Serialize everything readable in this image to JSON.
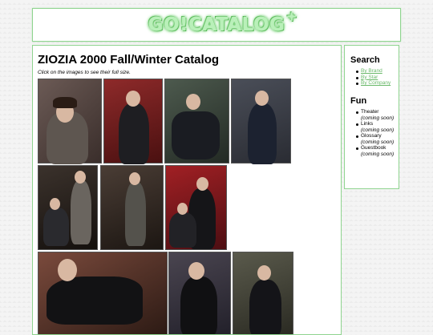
{
  "logo": {
    "text": "GO!CATALOG",
    "plus": "+"
  },
  "main": {
    "title": "ZIOZIA 2000 Fall/Winter Catalog",
    "hint": "Click on the images to see their full size."
  },
  "photos": [
    {
      "label": "photo-1",
      "bg": "#5a4a45"
    },
    {
      "label": "photo-2",
      "bg": "#7a2020"
    },
    {
      "label": "photo-3",
      "bg": "#3d4a3e"
    },
    {
      "label": "photo-4",
      "bg": "#3c3f46"
    },
    {
      "label": "photo-5",
      "bg": "#2b241f"
    },
    {
      "label": "photo-6",
      "bg": "#3a2f29"
    },
    {
      "label": "photo-7",
      "bg": "#8a1e22"
    },
    {
      "label": "photo-8",
      "bg": "#6a3a30"
    },
    {
      "label": "photo-9",
      "bg": "#3d3a40"
    },
    {
      "label": "photo-10",
      "bg": "#4a4a40"
    }
  ],
  "sidebar": {
    "search_heading": "Search",
    "search_links": [
      "By Brand",
      "By Star",
      "By Company"
    ],
    "fun_heading": "Fun",
    "fun_items": [
      {
        "label": "Theater",
        "note": "(coming soon)"
      },
      {
        "label": "Links",
        "note": "(coming soon)"
      },
      {
        "label": "Glossary",
        "note": "(coming soon)"
      },
      {
        "label": "Guestbook",
        "note": "(coming soon)"
      }
    ]
  },
  "colors": {
    "accent": "#8fd48f",
    "link": "#6ab96a"
  }
}
